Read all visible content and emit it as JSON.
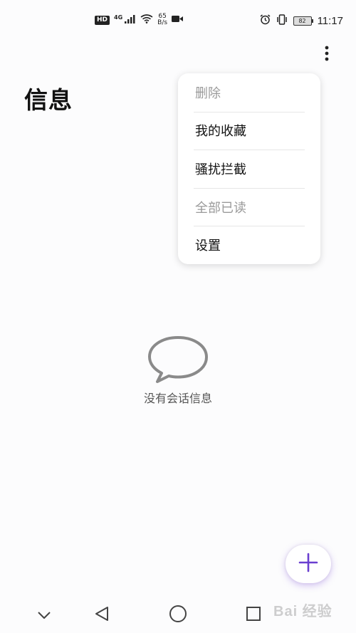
{
  "status_bar": {
    "hd": "HD",
    "network": "4G",
    "speed_value": "65",
    "speed_unit": "B/s",
    "battery": "82",
    "time": "11:17",
    "icons": [
      "signal-icon",
      "wifi-icon",
      "video-icon",
      "alarm-icon",
      "vibrate-icon",
      "battery-icon"
    ]
  },
  "header": {
    "title": "信息",
    "more_icon": "more-vertical-icon"
  },
  "menu": {
    "items": [
      {
        "label": "删除",
        "enabled": false
      },
      {
        "label": "我的收藏",
        "enabled": true
      },
      {
        "label": "骚扰拦截",
        "enabled": true
      },
      {
        "label": "全部已读",
        "enabled": false
      },
      {
        "label": "设置",
        "enabled": true
      }
    ]
  },
  "empty_state": {
    "icon": "chat-bubble-icon",
    "text": "没有会话信息"
  },
  "fab": {
    "icon": "plus-icon",
    "accent": "#6a3fd0"
  },
  "navigation": {
    "items": [
      "collapse-icon",
      "back-icon",
      "home-icon",
      "recents-icon"
    ]
  },
  "watermark": {
    "text": "Bai 经验"
  }
}
